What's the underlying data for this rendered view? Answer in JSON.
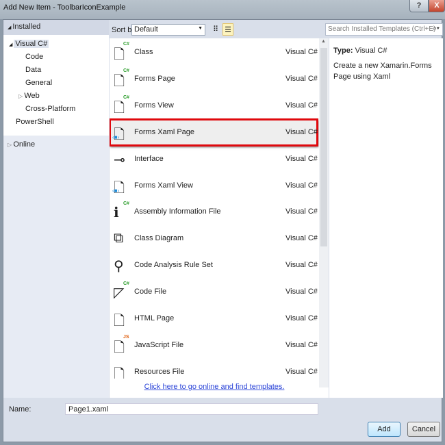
{
  "window": {
    "title": "Add New Item - ToolbarIconExample",
    "help": "?",
    "close": "X"
  },
  "sidebar": {
    "installed": "Installed",
    "tree": [
      {
        "label": "Visual C#",
        "arrow": "◢"
      },
      {
        "label": "Code"
      },
      {
        "label": "Data"
      },
      {
        "label": "General"
      },
      {
        "label": "Web",
        "arrow": "▷"
      },
      {
        "label": "Cross-Platform"
      },
      {
        "label": "PowerShell"
      }
    ],
    "online": "Online"
  },
  "toolbar": {
    "sort_label": "Sort by:",
    "sort_value": "Default",
    "search_placeholder": "Search Installed Templates (Ctrl+E)"
  },
  "templates": [
    {
      "name": "Class",
      "lang": "Visual C#",
      "icon": "cs-class-icon"
    },
    {
      "name": "Forms Page",
      "lang": "Visual C#",
      "icon": "cs-file-icon"
    },
    {
      "name": "Forms View",
      "lang": "Visual C#",
      "icon": "cs-file-icon"
    },
    {
      "name": "Forms Xaml Page",
      "lang": "Visual C#",
      "icon": "xaml-icon",
      "selected": true
    },
    {
      "name": "Interface",
      "lang": "Visual C#",
      "icon": "interface-icon"
    },
    {
      "name": "Forms Xaml View",
      "lang": "Visual C#",
      "icon": "xaml-icon"
    },
    {
      "name": "Assembly Information File",
      "lang": "Visual C#",
      "icon": "info-file-icon"
    },
    {
      "name": "Class Diagram",
      "lang": "Visual C#",
      "icon": "diagram-icon"
    },
    {
      "name": "Code Analysis Rule Set",
      "lang": "Visual C#",
      "icon": "ruleset-icon"
    },
    {
      "name": "Code File",
      "lang": "Visual C#",
      "icon": "code-file-icon"
    },
    {
      "name": "HTML Page",
      "lang": "Visual C#",
      "icon": "html-icon"
    },
    {
      "name": "JavaScript File",
      "lang": "Visual C#",
      "icon": "js-icon"
    },
    {
      "name": "Resources File",
      "lang": "Visual C#",
      "icon": "resources-icon"
    }
  ],
  "online_link": "Click here to go online and find templates.",
  "details": {
    "type_label": "Type:",
    "type_value": "Visual C#",
    "description": "Create a new Xamarin.Forms Page using Xaml"
  },
  "footer": {
    "name_label": "Name:",
    "name_value": "Page1.xaml",
    "add": "Add",
    "cancel": "Cancel"
  }
}
